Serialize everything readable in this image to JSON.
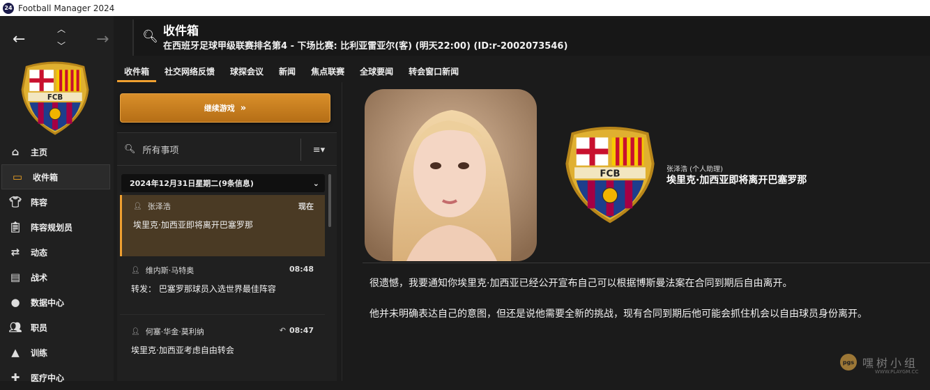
{
  "window": {
    "app_badge": "24",
    "title": "Football Manager 2024"
  },
  "header": {
    "title": "收件箱",
    "subtitle": "在西班牙足球甲级联赛排名第4 - 下场比赛: 比利亚雷亚尔(客) (明天22:00) (ID:r-2002073546)"
  },
  "club": {
    "logo_text": "FCB"
  },
  "sidebar": {
    "items": [
      {
        "label": "主页",
        "icon": "home-icon"
      },
      {
        "label": "收件箱",
        "icon": "inbox-icon",
        "active": true
      },
      {
        "label": "阵容",
        "icon": "shirt-icon"
      },
      {
        "label": "阵容规划员",
        "icon": "clipboard-icon"
      },
      {
        "label": "动态",
        "icon": "dynamics-icon"
      },
      {
        "label": "战术",
        "icon": "tactics-icon"
      },
      {
        "label": "数据中心",
        "icon": "data-hub-icon"
      },
      {
        "label": "职员",
        "icon": "staff-icon"
      },
      {
        "label": "训练",
        "icon": "training-icon"
      },
      {
        "label": "医疗中心",
        "icon": "medical-icon"
      }
    ]
  },
  "tabs": [
    "收件箱",
    "社交网络反馈",
    "球探会议",
    "新闻",
    "焦点联赛",
    "全球要闻",
    "转会窗口新闻"
  ],
  "continue_button": "继续游戏",
  "filter": {
    "label": "所有事项"
  },
  "date_group": "2024年12月31日星期二(9条信息)",
  "messages": [
    {
      "from": "张泽浩",
      "time": "现在",
      "subject": "埃里克·加西亚即将离开巴塞罗那"
    },
    {
      "from": "维内斯·马特奥",
      "time": "08:48",
      "subject": "转发： 巴塞罗那球员入选世界最佳阵容"
    },
    {
      "from": "何塞·华金·莫利纳",
      "time": "08:47",
      "subject": "埃里克·加西亚考虑自由转会"
    }
  ],
  "detail": {
    "sender": "张泽浩 (个人助理)",
    "subject": "埃里克·加西亚即将离开巴塞罗那",
    "body": [
      "很遗憾，我要通知你埃里克·加西亚已经公开宣布自己可以根据博斯曼法案在合同到期后自由离开。",
      "他并未明确表达自己的意图，但还是说他需要全新的挑战，现有合同到期后他可能会抓住机会以自由球员身份离开。"
    ]
  },
  "watermark": {
    "text": "嘿树小组",
    "url": "WWW.PLAYGM.CC",
    "badge": "pgs"
  },
  "colors": {
    "accent": "#f0a030",
    "background": "#1b1b1b",
    "panel": "#202020",
    "selected_row": "#4a3a24"
  }
}
